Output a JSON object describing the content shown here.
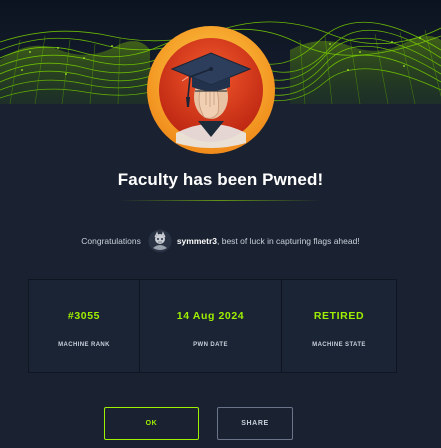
{
  "modal": {
    "title": "Faculty has been Pwned!",
    "congrats_prefix": "Congratulations",
    "username": "symmetr3",
    "congrats_suffix": ", best of luck in capturing flags ahead!"
  },
  "stats": [
    {
      "value": "#3055",
      "label": "MACHINE RANK"
    },
    {
      "value": "14 Aug 2024",
      "label": "PWN DATE"
    },
    {
      "value": "RETIRED",
      "label": "MACHINE STATE"
    }
  ],
  "buttons": {
    "ok_label": "OK",
    "share_label": "SHARE"
  },
  "icons": {
    "machine_avatar": "graduation-cap-professor-icon",
    "user_avatar": "user-avatar-icon"
  },
  "colors": {
    "accent": "#9fef00",
    "background": "#1a2231",
    "avatar_ring": "#f5a623"
  }
}
